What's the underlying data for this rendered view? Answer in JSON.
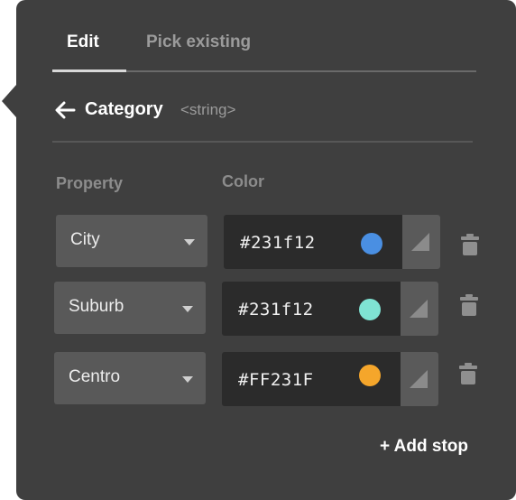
{
  "tabs": [
    {
      "label": "Edit",
      "active": true
    },
    {
      "label": "Pick existing",
      "active": false
    }
  ],
  "attribute": {
    "name": "Category",
    "type": "<string>"
  },
  "columns": {
    "property": "Property",
    "color": "Color"
  },
  "stops": [
    {
      "property": "City",
      "hex": "#231f12",
      "swatch": "#4a8fe2"
    },
    {
      "property": "Suburb",
      "hex": "#231f12",
      "swatch": "#7fe3d3"
    },
    {
      "property": "Centro",
      "hex": "#FF231F",
      "swatch": "#f5a62b"
    }
  ],
  "add_stop_label": "+ Add stop",
  "icons": {
    "back": "arrow-left-icon",
    "dropdown": "chevron-down-icon",
    "picker": "color-picker-icon",
    "delete": "trash-icon"
  }
}
